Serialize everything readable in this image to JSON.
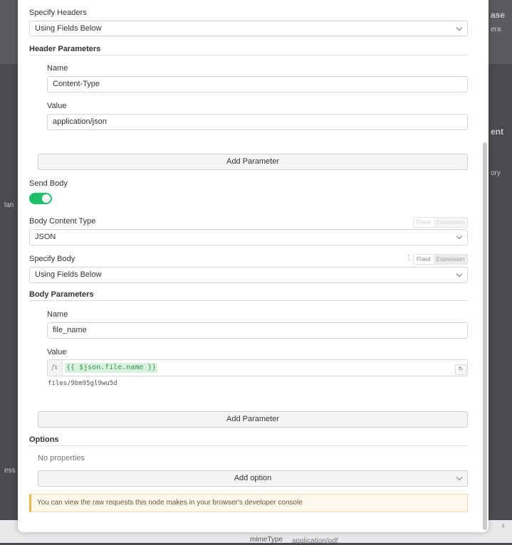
{
  "specify_headers": {
    "label": "Specify Headers",
    "value": "Using Fields Below"
  },
  "header_parameters": {
    "title": "Header Parameters",
    "name_label": "Name",
    "name_value": "Content-Type",
    "value_label": "Value",
    "value_value": "application/json",
    "add_button": "Add Parameter"
  },
  "send_body": {
    "label": "Send Body",
    "enabled": true
  },
  "body_content_type": {
    "label": "Body Content Type",
    "value": "JSON",
    "fixed": "Fixed",
    "expression": "Expression"
  },
  "specify_body": {
    "label": "Specify Body",
    "value": "Using Fields Below",
    "fixed": "Fixed",
    "expression": "Expression"
  },
  "body_parameters": {
    "title": "Body Parameters",
    "name_label": "Name",
    "name_value": "file_name",
    "value_label": "Value",
    "fx_label": "fx",
    "expression": "{{ $json.file.name }}",
    "resolved": "files/9bm95gl9wu5d",
    "add_button": "Add Parameter"
  },
  "options": {
    "title": "Options",
    "empty_text": "No properties",
    "add_button": "Add option"
  },
  "callout": {
    "text": "You can view the raw requests this node makes in your browser's developer console"
  },
  "background": {
    "right_snippets": [
      "ase",
      "era",
      "ent",
      "ory"
    ],
    "left_snippets": [
      "lan",
      "ess"
    ],
    "bottom_row": {
      "key": "mimeType",
      "value": "application/pdf"
    }
  },
  "colors": {
    "accent_green": "#1fbf6a",
    "callout_border": "#f3b64a",
    "expression_bg": "#d9f2df"
  }
}
